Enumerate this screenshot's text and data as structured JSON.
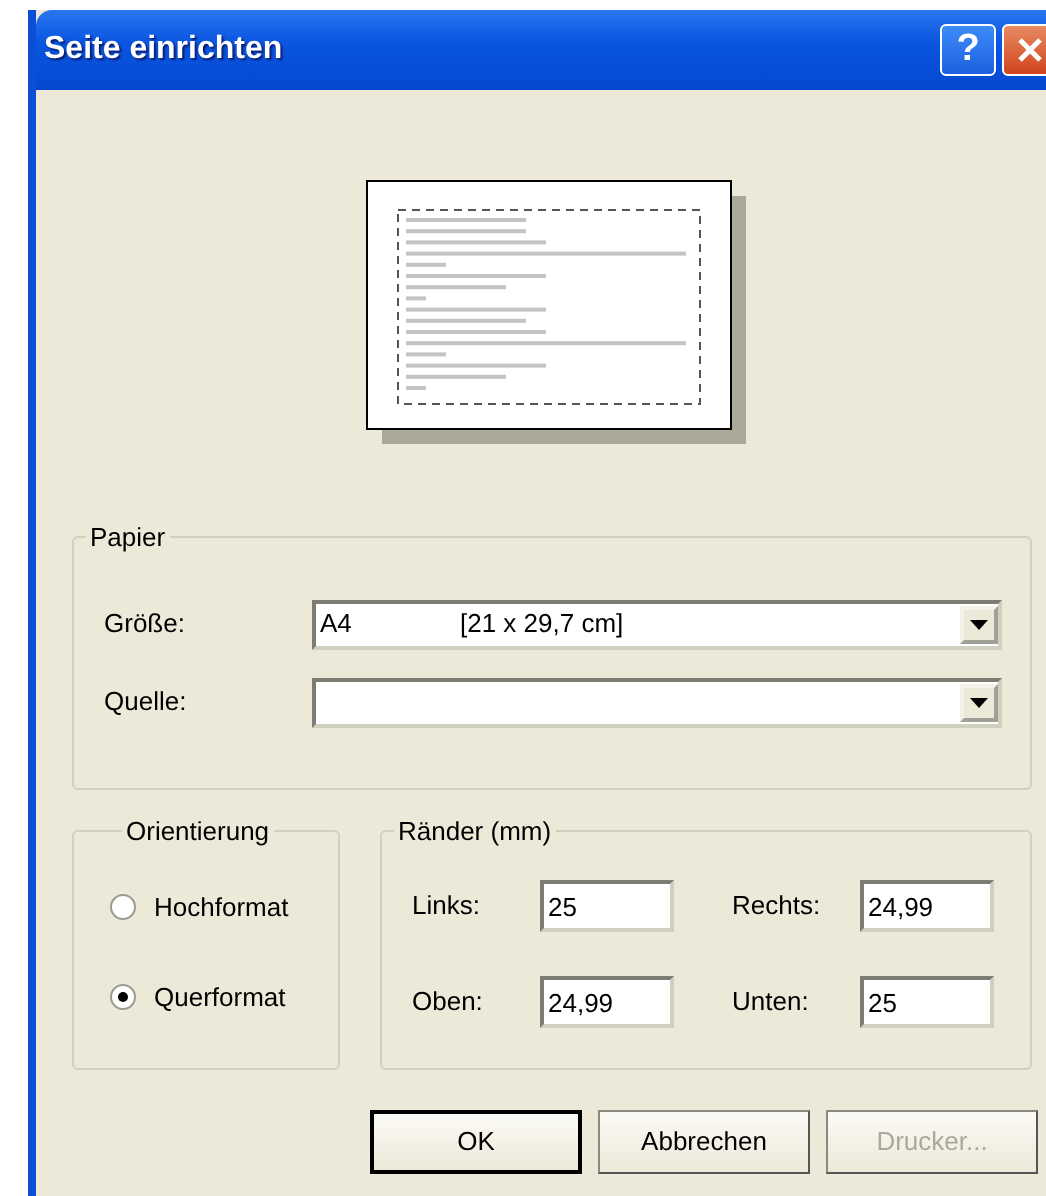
{
  "window": {
    "title": "Seite einrichten",
    "help": "?"
  },
  "paper": {
    "title": "Papier",
    "fields": [
      {
        "label": "Größe:",
        "value": "A4",
        "detail": "[21 x 29,7 cm]"
      },
      {
        "label": "Quelle:"
      }
    ]
  },
  "orientation": {
    "title": "Orientierung",
    "options": [
      {
        "label": "Hochformat",
        "selected": false
      },
      {
        "label": "Querformat",
        "selected": true
      }
    ]
  },
  "margins": {
    "title": "Ränder (mm)",
    "fields": [
      {
        "label": "Links:",
        "value": "25"
      },
      {
        "label": "Rechts:",
        "value": "24,99"
      },
      {
        "label": "Oben:",
        "value": "24,99"
      },
      {
        "label": "Unten:",
        "value": "25"
      }
    ]
  },
  "buttons": [
    {
      "label": "OK",
      "default": true,
      "disabled": false
    },
    {
      "label": "Abbrechen",
      "default": false,
      "disabled": false
    },
    {
      "label": "Drucker...",
      "default": false,
      "disabled": true
    }
  ]
}
